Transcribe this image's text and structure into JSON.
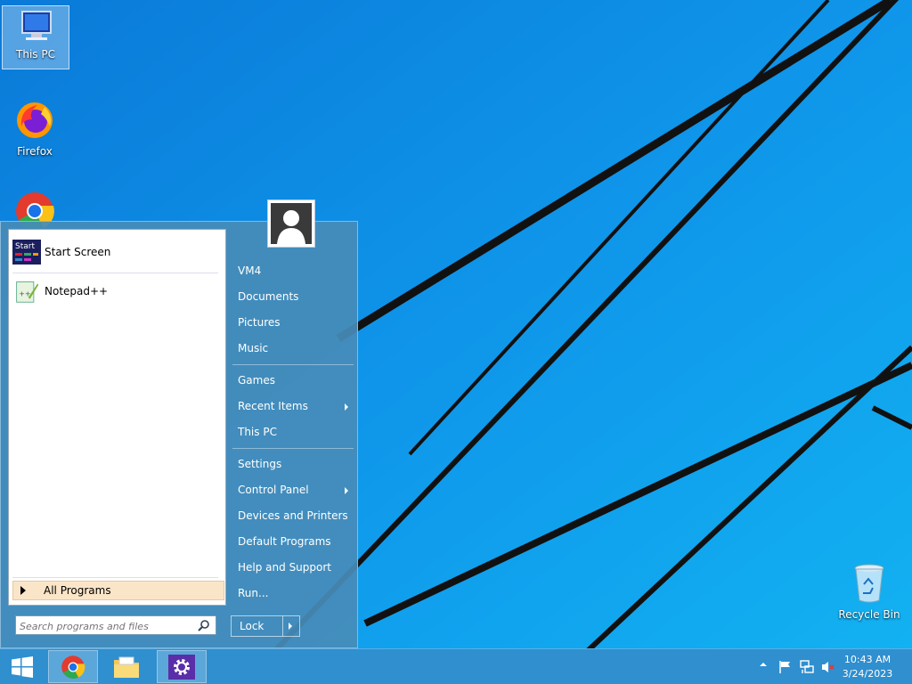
{
  "desktop": {
    "icons": [
      {
        "label": "This PC"
      },
      {
        "label": "Firefox"
      },
      {
        "label": "Chrome"
      },
      {
        "label": "Recycle Bin"
      }
    ]
  },
  "start_menu": {
    "pinned": [
      {
        "label": "Start Screen",
        "icon": "start-screen-icon"
      },
      {
        "label": "Notepad++",
        "icon": "notepad-plus-plus-icon"
      }
    ],
    "all_programs": "All Programs",
    "search": {
      "placeholder": "Search programs and files"
    },
    "right_items": [
      {
        "label": "VM4"
      },
      {
        "label": "Documents"
      },
      {
        "label": "Pictures"
      },
      {
        "label": "Music"
      },
      {
        "label": "Games"
      },
      {
        "label": "Recent Items",
        "submenu": true
      },
      {
        "label": "This PC"
      },
      {
        "label": "Settings"
      },
      {
        "label": "Control Panel",
        "submenu": true
      },
      {
        "label": "Devices and Printers"
      },
      {
        "label": "Default Programs"
      },
      {
        "label": "Help and Support"
      },
      {
        "label": "Run..."
      }
    ],
    "lock": "Lock",
    "start_tile_text": "Start"
  },
  "taskbar": {
    "apps": [
      "start-button",
      "chrome",
      "file-explorer",
      "settings"
    ],
    "clock": {
      "time": "10:43 AM",
      "date": "3/24/2023"
    }
  },
  "colors": {
    "wallpaper": "#0f8fe8",
    "start_menu": "#468cb9",
    "taskbar": "#2f8fcf",
    "all_programs_highlight": "#fbe5c8"
  }
}
